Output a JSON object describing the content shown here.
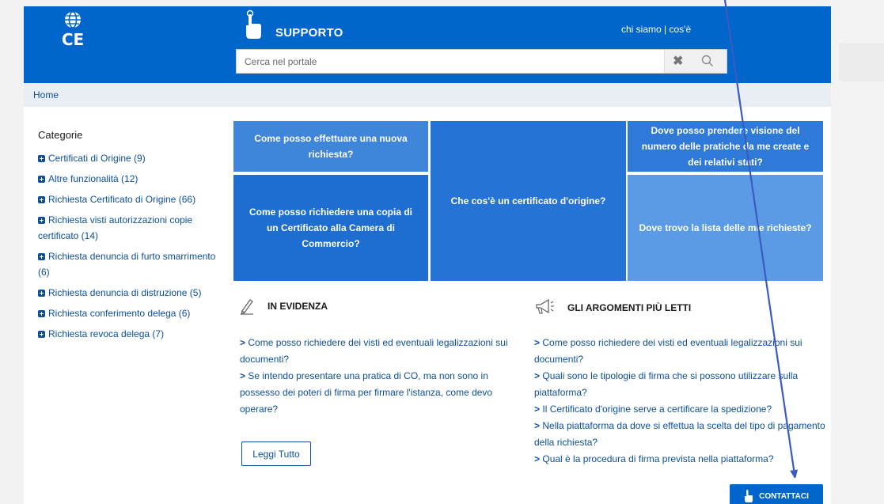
{
  "header": {
    "logo_text": "CE",
    "title": "SUPPORTO",
    "links": {
      "chi_siamo": "chi siamo",
      "separator": "|",
      "cose": "cos'è"
    },
    "search_placeholder": "Cerca nel portale"
  },
  "breadcrumb": {
    "home": "Home"
  },
  "sidebar": {
    "title": "Categorie",
    "items": [
      {
        "label": "Certificati di Origine (9)"
      },
      {
        "label": "Altre funzionalità (12)"
      },
      {
        "label": "Richiesta Certificato di Origine (66)"
      },
      {
        "label": "Richiesta visti autorizzazioni copie certificato (14)"
      },
      {
        "label": "Richiesta denuncia di furto smarrimento (6)"
      },
      {
        "label": "Richiesta denuncia di distruzione (5)"
      },
      {
        "label": "Richiesta conferimento delega (6)"
      },
      {
        "label": "Richiesta revoca delega (7)"
      }
    ]
  },
  "tiles": [
    {
      "label": "Come posso effettuare una nuova richiesta?"
    },
    {
      "label": "Come posso richiedere una copia di un Certificato alla Camera di Commercio?"
    },
    {
      "label": "Che cos'è un certificato d'origine?"
    },
    {
      "label": "Dove posso prendere visione del numero delle pratiche da me create e dei relativi stati?"
    },
    {
      "label": "Dove trovo la lista delle mie richieste?"
    }
  ],
  "in_evidenza": {
    "title": "IN EVIDENZA",
    "items": [
      {
        "label": "Come posso richiedere dei visti ed eventuali legalizzazioni sui documenti?"
      },
      {
        "label": "Se intendo presentare una pratica di CO, ma non sono in possesso dei poteri di firma per firmare l'istanza, come devo operare?"
      }
    ],
    "button": "Leggi Tutto"
  },
  "argomenti": {
    "title": "GLI ARGOMENTI PIÙ LETTI",
    "items": [
      {
        "label": "Come posso richiedere dei visti ed eventuali legalizzazioni sui documenti?"
      },
      {
        "label": "Quali sono le tipologie di firma che si possono utilizzare sulla piattaforma?"
      },
      {
        "label": "Il Certificato d'origine serve a certificare la spedizione?"
      },
      {
        "label": "Nella piattaforma da dove si effettua la scelta del tipo di pagamento della richiesta?"
      },
      {
        "label": "Qual è la procedura di firma prevista nella piattaforma?"
      }
    ]
  },
  "contact_button": "CONTATTACI",
  "icons": {
    "logo": "globe-icon",
    "support": "pointing-hand-icon",
    "clear": "close-icon",
    "search": "search-icon",
    "evidenza": "pencil-icon",
    "argomenti": "megaphone-icon",
    "contact": "pointing-hand-icon"
  },
  "colors": {
    "brand": "#0066cc",
    "link": "#0b4f9c"
  }
}
